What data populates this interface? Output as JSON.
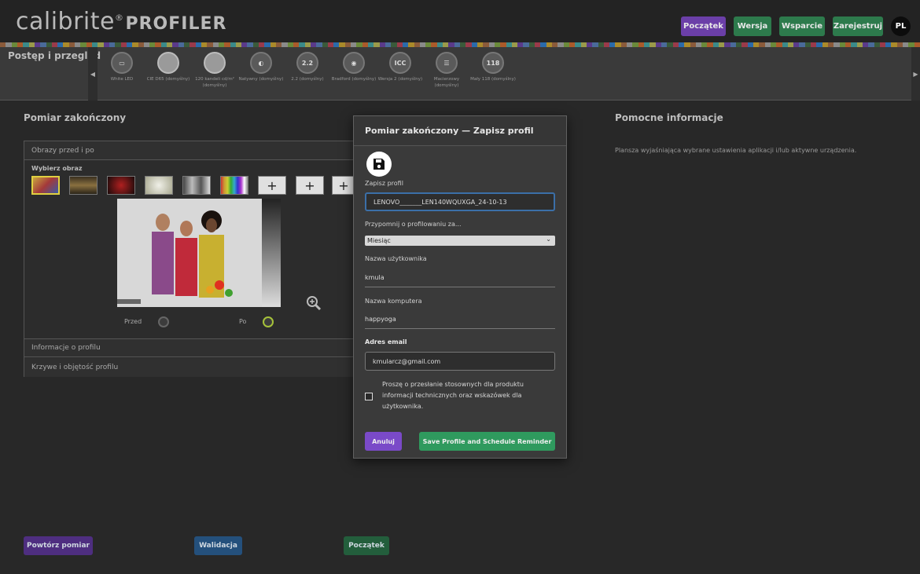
{
  "header": {
    "logo_main": "calibrite",
    "logo_reg": "®",
    "logo_product": "PROFILER",
    "buttons": [
      {
        "label": "Początek",
        "color": "#6b3fa8"
      },
      {
        "label": "Wersja",
        "color": "#2d7a4c"
      },
      {
        "label": "Wsparcie",
        "color": "#2d7a4c"
      },
      {
        "label": "Zarejestruj",
        "color": "#2d7a4c"
      }
    ],
    "avatar": "PL"
  },
  "progress": {
    "title": "Postęp i przegląd",
    "steps": [
      {
        "icon": "monitor-icon",
        "glyph": "▭",
        "label": "White LED"
      },
      {
        "icon": "whitepoint-icon",
        "glyph": "",
        "label": "CIE D65 (domyślny)"
      },
      {
        "icon": "luminance-icon",
        "glyph": "",
        "label": "120 kandeli cd/m² (domyślny)"
      },
      {
        "icon": "contrast-icon",
        "glyph": "◐",
        "label": "Natywny (domyślny)"
      },
      {
        "icon": "gamma-icon",
        "glyph": "2.2",
        "label": "2.2 (domyślny)"
      },
      {
        "icon": "bradford-icon",
        "glyph": "◉",
        "label": "Bradford (domyślny)"
      },
      {
        "icon": "icc-icon",
        "glyph": "ICC",
        "label": "Wersja 2 (domyślny)"
      },
      {
        "icon": "sliders-icon",
        "glyph": "☰",
        "label": "Macierzowy (domyślny)"
      },
      {
        "icon": "patch-icon",
        "glyph": "118",
        "label": "Mały 118 (domyślny)"
      }
    ]
  },
  "main": {
    "title": "Pomiar zakończony",
    "before_after": "Obrazy przed i po",
    "choose_image": "Wybierz obraz",
    "plus": "+",
    "before": "Przed",
    "after": "Po",
    "profile_info": "Informacje o profilu",
    "curves": "Krzywe i objętość profilu"
  },
  "help": {
    "title": "Pomocne informacje",
    "text": "Plansza wyjaśniająca wybrane ustawienia aplikacji i/lub aktywne urządzenia."
  },
  "bottom": {
    "repeat": "Powtórz pomiar",
    "validate": "Walidacja",
    "home": "Początek"
  },
  "modal": {
    "title": "Pomiar zakończony — Zapisz profil",
    "save_profile_label": "Zapisz profil",
    "profile_name": "LENOVO_______LEN140WQUXGA_24-10-13",
    "reminder_label": "Przypomnij o profilowaniu za...",
    "reminder_value": "Miesiąc",
    "username_label": "Nazwa użytkownika",
    "username_value": "kmula",
    "computer_label": "Nazwa komputera",
    "computer_value": "happyoga",
    "email_label": "Adres email",
    "email_value": "kmularcz@gmail.com",
    "consent_text": "Proszę o przesłanie stosownych dla produktu informacji technicznych oraz wskazówek dla użytkownika.",
    "cancel": "Anuluj",
    "save_schedule": "Save Profile and Schedule Reminder"
  }
}
